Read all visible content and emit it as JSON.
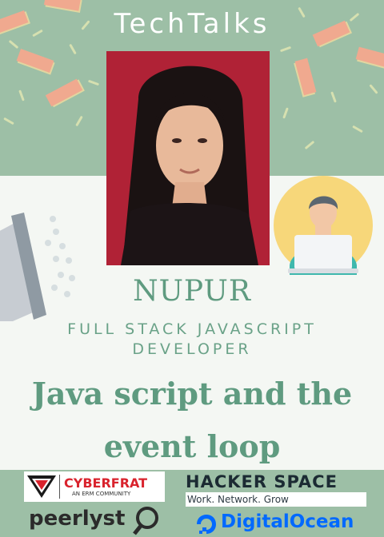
{
  "header": {
    "brand_title": "TechTalks"
  },
  "speaker": {
    "name": "NUPUR",
    "role_line1": "FULL STACK JAVASCRIPT",
    "role_line2": "DEVELOPER"
  },
  "talk": {
    "title_line1": "Java script and the",
    "title_line2": "event loop"
  },
  "sponsors": {
    "cyberfrat": {
      "name": "CYBERFRAT",
      "tagline": "AN ERM COMMUNITY"
    },
    "hackerspace": {
      "name": "HACKER SPACE",
      "tagline": "Work. Network. Grow"
    },
    "peerlyst": {
      "name": "peerlyst"
    },
    "digitalocean": {
      "name": "DigitalOcean"
    }
  },
  "colors": {
    "band_green": "#9dbfa6",
    "accent_green": "#5f9b80",
    "background": "#f4f7f3",
    "photo_red": "#b02236",
    "illustration_yellow": "#f7d77a",
    "digitalocean_blue": "#0069ff",
    "cyberfrat_red": "#d9232d"
  },
  "icons": {
    "megaphone": "megaphone-icon",
    "laptop_user": "laptop-user-icon"
  }
}
